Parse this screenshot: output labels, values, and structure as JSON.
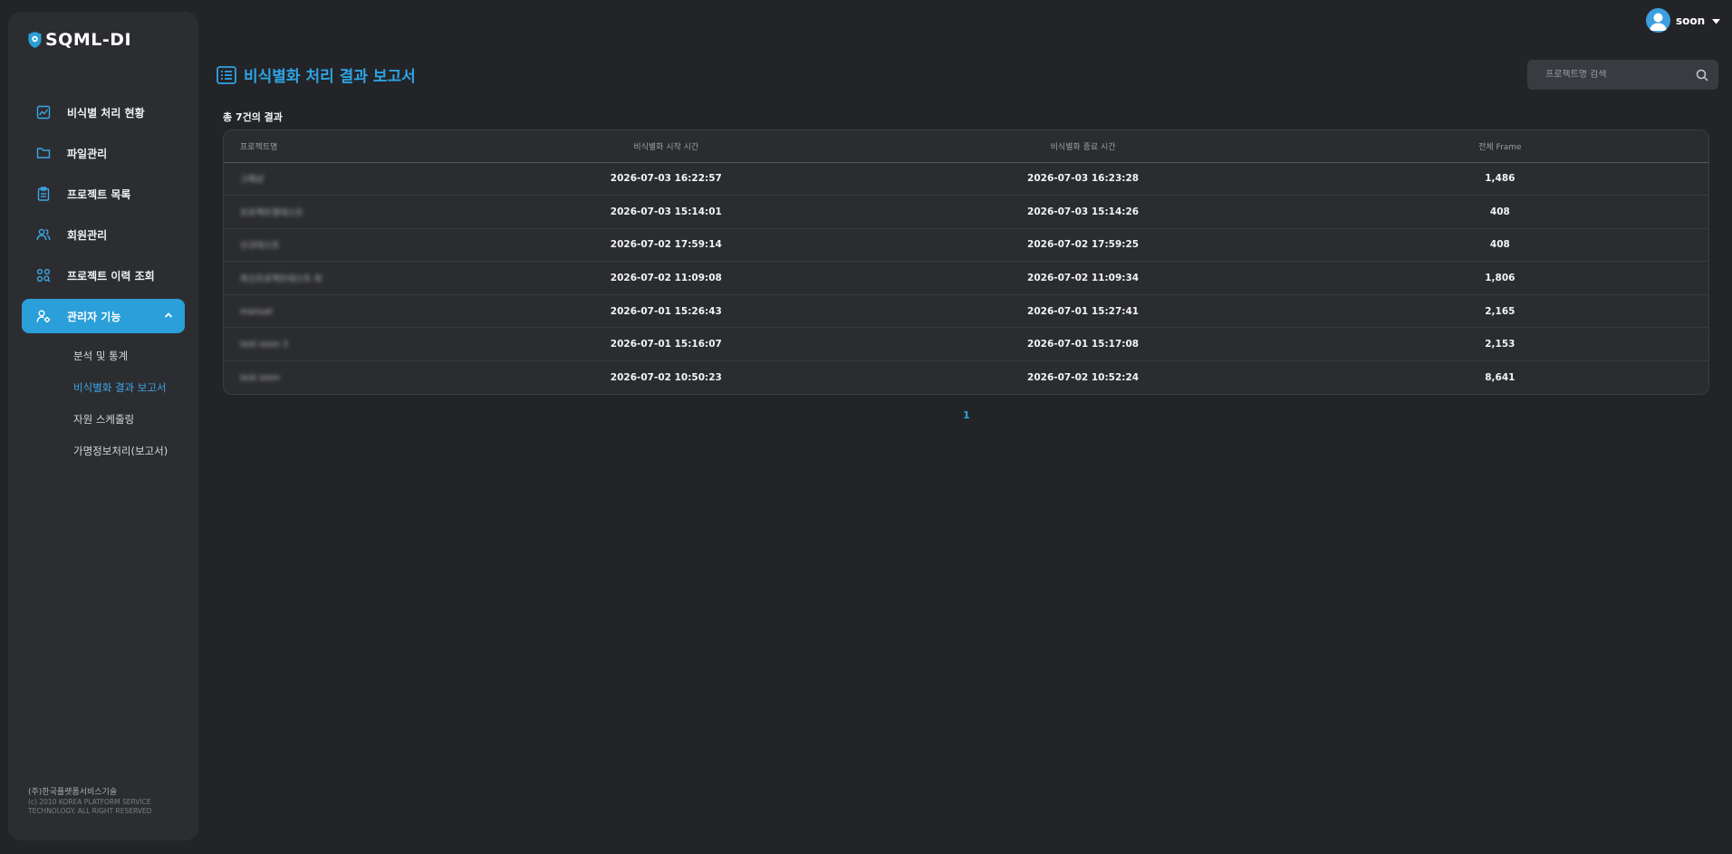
{
  "app": {
    "logo_text": "SQML-DI"
  },
  "sidebar": {
    "items": [
      {
        "label": "비식별 처리 현황",
        "icon": "chart-icon"
      },
      {
        "label": "파일관리",
        "icon": "folder-icon"
      },
      {
        "label": "프로젝트 목록",
        "icon": "clipboard-icon"
      },
      {
        "label": "회원관리",
        "icon": "users-icon"
      },
      {
        "label": "프로젝트 이력 조회",
        "icon": "search-history-icon"
      },
      {
        "label": "관리자 기능",
        "icon": "admin-icon",
        "expanded": true
      }
    ],
    "subitems": [
      {
        "label": "분석 및 통계"
      },
      {
        "label": "비식별화 결과 보고서",
        "current": true
      },
      {
        "label": "자원 스케줄링"
      },
      {
        "label": "가명정보처리(보고서)"
      }
    ],
    "footer": {
      "company": "(주)한국플랫폼서비스기술",
      "copyright": "(c) 2010 KOREA PLATFORM SERVICE TECHNOLOGY. ALL RIGHT RESERVED"
    }
  },
  "header": {
    "username": "soon"
  },
  "page": {
    "title": "비식별화 처리 결과 보고서",
    "search_placeholder": "프로젝트명 검색",
    "result_count": "총 7건의 결과"
  },
  "table": {
    "headers": [
      "프로젝트명",
      "비식별화 시작 시간",
      "비식별화 종료 시간",
      "전체 Frame"
    ],
    "rows": [
      {
        "name": "고해상",
        "start": "2026-07-03 16:22:57",
        "end": "2026-07-03 16:23:28",
        "frames": "1,486"
      },
      {
        "name": "프로젝트명테스트",
        "start": "2026-07-03 15:14:01",
        "end": "2026-07-03 15:14:26",
        "frames": "408"
      },
      {
        "name": "신규테스트",
        "start": "2026-07-02 17:59:14",
        "end": "2026-07-02 17:59:25",
        "frames": "408"
      },
      {
        "name": "최신프로젝트테스트 최",
        "start": "2026-07-02 11:09:08",
        "end": "2026-07-02 11:09:34",
        "frames": "1,806"
      },
      {
        "name": "manual",
        "start": "2026-07-01 15:26:43",
        "end": "2026-07-01 15:27:41",
        "frames": "2,165"
      },
      {
        "name": "test soon 3",
        "start": "2026-07-01 15:16:07",
        "end": "2026-07-01 15:17:08",
        "frames": "2,153"
      },
      {
        "name": "test soon",
        "start": "2026-07-02 10:50:23",
        "end": "2026-07-02 10:52:24",
        "frames": "8,641"
      }
    ]
  },
  "pagination": {
    "current": "1"
  },
  "colors": {
    "accent": "#2ea3e4",
    "background": "#232427",
    "sidebar": "#2c2d31",
    "active": "#2a9fd9"
  }
}
